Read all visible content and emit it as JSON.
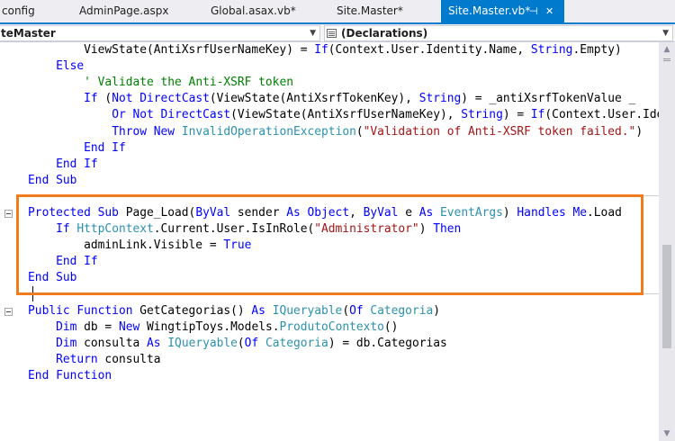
{
  "tabs": [
    {
      "label": "config",
      "active": false
    },
    {
      "label": "AdminPage.aspx",
      "active": false
    },
    {
      "label": "Global.asax.vb*",
      "active": false
    },
    {
      "label": "Site.Master*",
      "active": false
    },
    {
      "label": "Site.Master.vb*",
      "active": true
    }
  ],
  "tab_icons": {
    "pin": "⊣",
    "close": "✕",
    "pin_icon_name": "pin-icon",
    "close_icon_name": "close-icon"
  },
  "navbar": {
    "type_combo": "teMaster",
    "member_combo": "(Declarations)"
  },
  "colors": {
    "accent": "#007acc",
    "keyword": "#0000ff",
    "type": "#2b91af",
    "string": "#a31515",
    "comment": "#008000",
    "highlight_border": "#f07c1e"
  },
  "code_lines": [
    [
      {
        "c": "pl",
        "t": "            ViewState(AntiXsrfUserNameKey) = "
      },
      {
        "c": "kw",
        "t": "If"
      },
      {
        "c": "pl",
        "t": "(Context.User.Identity.Name, "
      },
      {
        "c": "kw",
        "t": "String"
      },
      {
        "c": "pl",
        "t": ".Empty)"
      }
    ],
    [
      {
        "c": "pl",
        "t": "        "
      },
      {
        "c": "kw",
        "t": "Else"
      }
    ],
    [
      {
        "c": "pl",
        "t": "            "
      },
      {
        "c": "cm",
        "t": "' Validate the Anti-XSRF token"
      }
    ],
    [
      {
        "c": "pl",
        "t": "            "
      },
      {
        "c": "kw",
        "t": "If"
      },
      {
        "c": "pl",
        "t": " ("
      },
      {
        "c": "kw",
        "t": "Not"
      },
      {
        "c": "pl",
        "t": " "
      },
      {
        "c": "kw",
        "t": "DirectCast"
      },
      {
        "c": "pl",
        "t": "(ViewState(AntiXsrfTokenKey), "
      },
      {
        "c": "kw",
        "t": "String"
      },
      {
        "c": "pl",
        "t": ") = _antiXsrfTokenValue _"
      }
    ],
    [
      {
        "c": "pl",
        "t": "                "
      },
      {
        "c": "kw",
        "t": "Or"
      },
      {
        "c": "pl",
        "t": " "
      },
      {
        "c": "kw",
        "t": "Not"
      },
      {
        "c": "pl",
        "t": " "
      },
      {
        "c": "kw",
        "t": "DirectCast"
      },
      {
        "c": "pl",
        "t": "(ViewState(AntiXsrfUserNameKey), "
      },
      {
        "c": "kw",
        "t": "String"
      },
      {
        "c": "pl",
        "t": ") = "
      },
      {
        "c": "kw",
        "t": "If"
      },
      {
        "c": "pl",
        "t": "(Context.User.Ide"
      }
    ],
    [
      {
        "c": "pl",
        "t": "                "
      },
      {
        "c": "kw",
        "t": "Throw"
      },
      {
        "c": "pl",
        "t": " "
      },
      {
        "c": "kw",
        "t": "New"
      },
      {
        "c": "pl",
        "t": " "
      },
      {
        "c": "ty",
        "t": "InvalidOperationException"
      },
      {
        "c": "pl",
        "t": "("
      },
      {
        "c": "st",
        "t": "\"Validation of Anti-XSRF token failed.\""
      },
      {
        "c": "pl",
        "t": ")"
      }
    ],
    [
      {
        "c": "pl",
        "t": "            "
      },
      {
        "c": "kw",
        "t": "End If"
      }
    ],
    [
      {
        "c": "pl",
        "t": "        "
      },
      {
        "c": "kw",
        "t": "End If"
      }
    ],
    [
      {
        "c": "pl",
        "t": "    "
      },
      {
        "c": "kw",
        "t": "End Sub"
      }
    ],
    [],
    [
      {
        "c": "pl",
        "t": "    "
      },
      {
        "c": "kw",
        "t": "Protected Sub"
      },
      {
        "c": "pl",
        "t": " Page_Load("
      },
      {
        "c": "kw",
        "t": "ByVal"
      },
      {
        "c": "pl",
        "t": " sender "
      },
      {
        "c": "kw",
        "t": "As Object"
      },
      {
        "c": "pl",
        "t": ", "
      },
      {
        "c": "kw",
        "t": "ByVal"
      },
      {
        "c": "pl",
        "t": " e "
      },
      {
        "c": "kw",
        "t": "As"
      },
      {
        "c": "pl",
        "t": " "
      },
      {
        "c": "ty",
        "t": "EventArgs"
      },
      {
        "c": "pl",
        "t": ") "
      },
      {
        "c": "kw",
        "t": "Handles Me"
      },
      {
        "c": "pl",
        "t": ".Load"
      }
    ],
    [
      {
        "c": "pl",
        "t": "        "
      },
      {
        "c": "kw",
        "t": "If"
      },
      {
        "c": "pl",
        "t": " "
      },
      {
        "c": "ty",
        "t": "HttpContext"
      },
      {
        "c": "pl",
        "t": ".Current.User.IsInRole("
      },
      {
        "c": "st",
        "t": "\"Administrator\""
      },
      {
        "c": "pl",
        "t": ") "
      },
      {
        "c": "kw",
        "t": "Then"
      }
    ],
    [
      {
        "c": "pl",
        "t": "            adminLink.Visible = "
      },
      {
        "c": "kw",
        "t": "True"
      }
    ],
    [
      {
        "c": "pl",
        "t": "        "
      },
      {
        "c": "kw",
        "t": "End If"
      }
    ],
    [
      {
        "c": "pl",
        "t": "    "
      },
      {
        "c": "kw",
        "t": "End Sub"
      }
    ],
    [],
    [
      {
        "c": "pl",
        "t": "    "
      },
      {
        "c": "kw",
        "t": "Public Function"
      },
      {
        "c": "pl",
        "t": " GetCategorias() "
      },
      {
        "c": "kw",
        "t": "As"
      },
      {
        "c": "pl",
        "t": " "
      },
      {
        "c": "ty",
        "t": "IQueryable"
      },
      {
        "c": "pl",
        "t": "("
      },
      {
        "c": "kw",
        "t": "Of"
      },
      {
        "c": "pl",
        "t": " "
      },
      {
        "c": "ty",
        "t": "Categoria"
      },
      {
        "c": "pl",
        "t": ")"
      }
    ],
    [
      {
        "c": "pl",
        "t": "        "
      },
      {
        "c": "kw",
        "t": "Dim"
      },
      {
        "c": "pl",
        "t": " db = "
      },
      {
        "c": "kw",
        "t": "New"
      },
      {
        "c": "pl",
        "t": " WingtipToys.Models."
      },
      {
        "c": "ty",
        "t": "ProdutoContexto"
      },
      {
        "c": "pl",
        "t": "()"
      }
    ],
    [
      {
        "c": "pl",
        "t": "        "
      },
      {
        "c": "kw",
        "t": "Dim"
      },
      {
        "c": "pl",
        "t": " consulta "
      },
      {
        "c": "kw",
        "t": "As"
      },
      {
        "c": "pl",
        "t": " "
      },
      {
        "c": "ty",
        "t": "IQueryable"
      },
      {
        "c": "pl",
        "t": "("
      },
      {
        "c": "kw",
        "t": "Of"
      },
      {
        "c": "pl",
        "t": " "
      },
      {
        "c": "ty",
        "t": "Categoria"
      },
      {
        "c": "pl",
        "t": ") = db.Categorias"
      }
    ],
    [
      {
        "c": "pl",
        "t": "        "
      },
      {
        "c": "kw",
        "t": "Return"
      },
      {
        "c": "pl",
        "t": " consulta"
      }
    ],
    [
      {
        "c": "pl",
        "t": "    "
      },
      {
        "c": "kw",
        "t": "End Function"
      }
    ]
  ]
}
